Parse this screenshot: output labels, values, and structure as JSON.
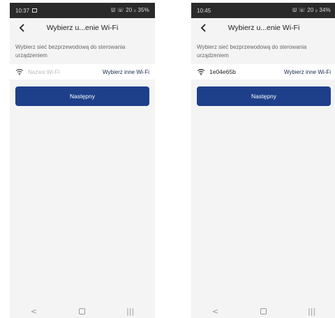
{
  "left": {
    "status": {
      "time": "10:37",
      "right": "ᗯ ☏ 20 ᵢₗ 35%"
    },
    "header": {
      "title": "Wybierz u...enie Wi-Fi"
    },
    "description": "Wybierz sieć bezprzewodową do sterowania urządzeniem",
    "wifi": {
      "placeholder": "Nazwa Wi-Fi",
      "choose_other": "Wybierz inne Wi-Fi"
    },
    "next_label": "Następny"
  },
  "right": {
    "status": {
      "time": "10:45",
      "right": "ᗯ ☏ 20 ᵢₗ 34%"
    },
    "header": {
      "title": "Wybierz u...enie Wi-Fi"
    },
    "description": "Wybierz sieć bezprzewodową do sterowania urządzeniem",
    "wifi": {
      "name": "1e04e65b",
      "choose_other": "Wybierz inne Wi-Fi"
    },
    "next_label": "Następny"
  },
  "nav": {
    "back": "<",
    "recent": "|||"
  },
  "colors": {
    "accent": "#1e3f8a",
    "status_bar": "#2a2a2a",
    "background": "#f4f4f4"
  },
  "icons": [
    "back-arrow-icon",
    "wifi-icon",
    "nav-back-icon",
    "nav-home-icon",
    "nav-recent-icon"
  ]
}
